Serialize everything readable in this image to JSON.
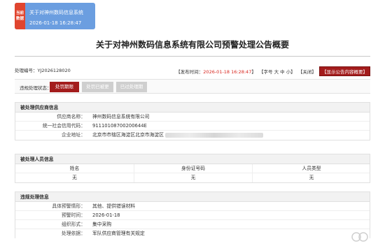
{
  "top_card": {
    "badge": "当前 数据",
    "title": "关于对神州数码信息系统",
    "datetime": "2026-01-18 16:28:47"
  },
  "page_title": "关于对神州数码信息系统有限公司预警处理公告概要",
  "meta": {
    "doc_no_label": "处理编号：",
    "doc_no": "YJ2026128020",
    "publish_label": "【发布时间：",
    "publish_time": "2026-01-18 16:28:47",
    "publish_close": "】",
    "font_label": "【字号",
    "font_big": "大",
    "font_mid": "中",
    "font_small": "小",
    "font_close": "】",
    "close_label": "【关闭】",
    "show_content_label": "【显示公告内容概要】"
  },
  "status": {
    "label": "违规处理状态：",
    "buttons": [
      "处罚期限内",
      "处罚已被更正",
      "已过处理期限"
    ]
  },
  "supplier": {
    "header": "被处理供应商信息",
    "rows": [
      {
        "key": "供应商名称：",
        "value": "神州数码信息系统有限公司"
      },
      {
        "key": "统一社会信用代码：",
        "value": "91110108700200644E"
      },
      {
        "key": "企业地址：",
        "value": "北京市市辖区海淀区北京市海淀区"
      }
    ]
  },
  "personnel": {
    "header": "被处理人员信息",
    "columns": [
      "姓名",
      "身份证号码",
      "人员类型"
    ],
    "row": [
      "无",
      "无",
      "无"
    ]
  },
  "violation": {
    "header": "违规处理信息",
    "rows": [
      {
        "key": "具体预警情形：",
        "value": "其他、提供错误材料"
      },
      {
        "key": "预警时间：",
        "value": "2026-01-18"
      },
      {
        "key": "组织形式：",
        "value": "集中采购"
      },
      {
        "key": "处理依据：",
        "value": "军队供应商管理有关规定"
      }
    ]
  },
  "colors": {
    "accent_red": "#a31c1c",
    "top_card_blue": "#6b9ee0",
    "badge_red": "#e0452f"
  }
}
